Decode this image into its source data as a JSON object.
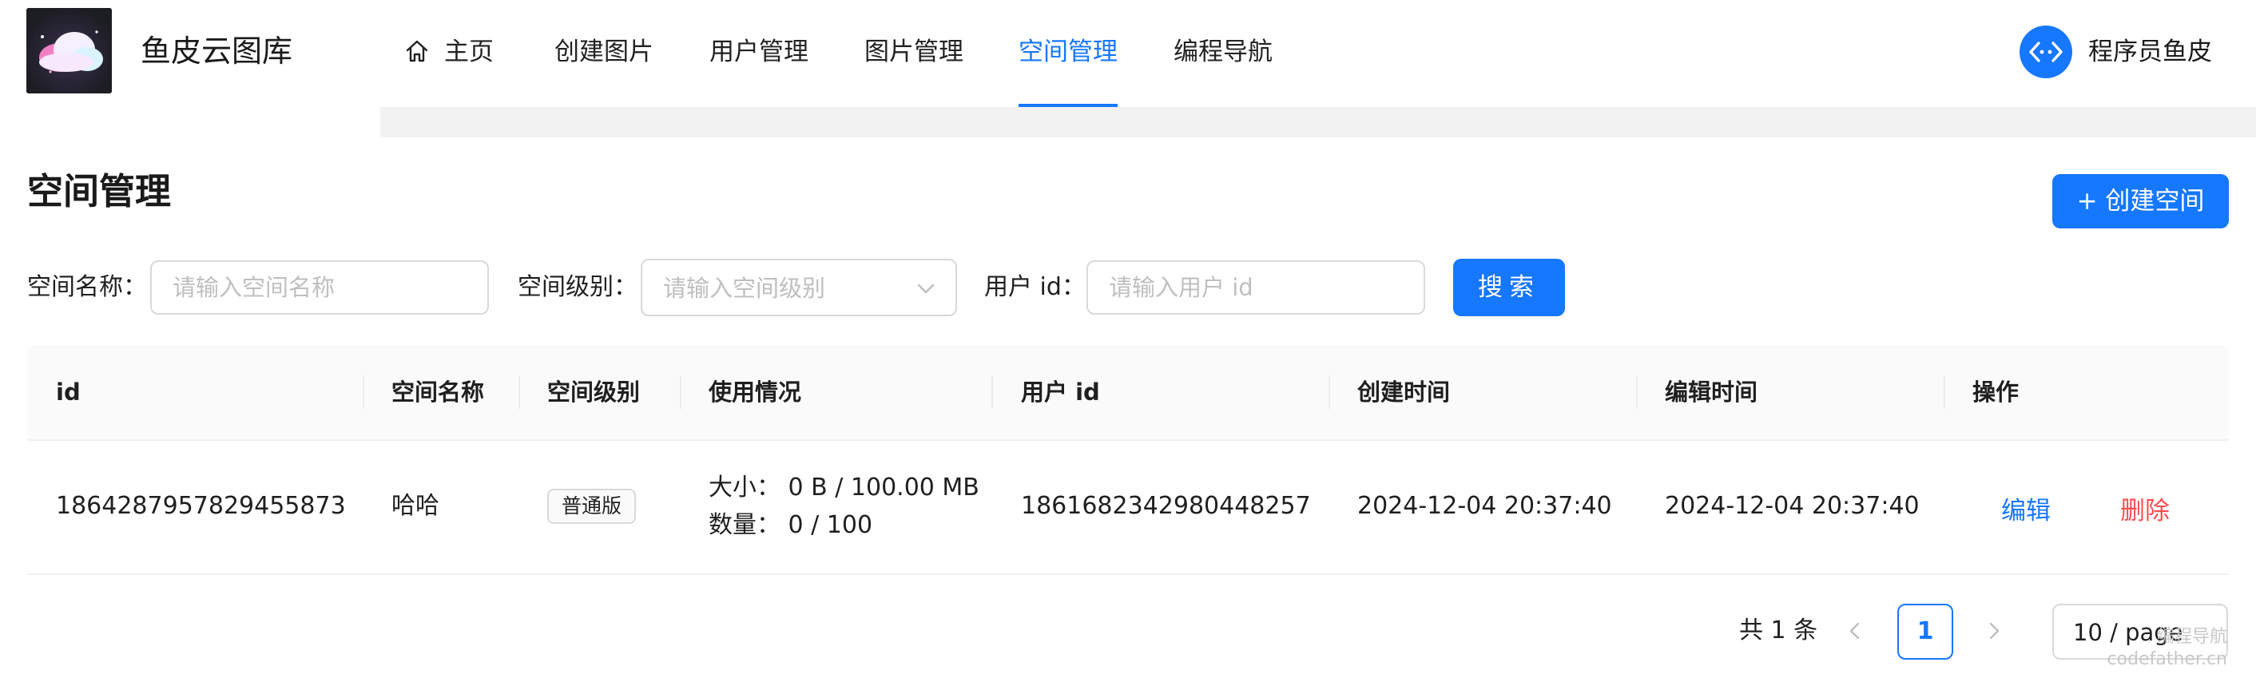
{
  "app": {
    "name": "鱼皮云图库"
  },
  "nav": {
    "items": [
      {
        "label": "主页",
        "icon": "home-icon"
      },
      {
        "label": "创建图片"
      },
      {
        "label": "用户管理"
      },
      {
        "label": "图片管理"
      },
      {
        "label": "空间管理",
        "active": true
      },
      {
        "label": "编程导航"
      }
    ]
  },
  "user": {
    "name": "程序员鱼皮"
  },
  "page": {
    "title": "空间管理",
    "create_button": "+ 创建空间"
  },
  "filters": {
    "space_name": {
      "label": "空间名称：",
      "placeholder": "请输入空间名称"
    },
    "space_level": {
      "label": "空间级别：",
      "placeholder": "请输入空间级别"
    },
    "user_id": {
      "label": "用户 id：",
      "placeholder": "请输入用户 id"
    },
    "search_button": "搜索"
  },
  "table": {
    "columns": [
      "id",
      "空间名称",
      "空间级别",
      "使用情况",
      "用户 id",
      "创建时间",
      "编辑时间",
      "操作"
    ],
    "rows": [
      {
        "id": "1864287957829455873",
        "space_name": "哈哈",
        "space_level": "普通版",
        "usage_size": "大小：  0 B / 100.00 MB",
        "usage_count": "数量：  0 / 100",
        "user_id": "1861682342980448257",
        "create_time": "2024-12-04 20:37:40",
        "edit_time": "2024-12-04 20:37:40",
        "edit_label": "编辑",
        "delete_label": "删除"
      }
    ]
  },
  "pagination": {
    "total_label": "共 1 条",
    "current_page": "1",
    "page_size": "10 / page"
  },
  "watermark": {
    "line1": "编程导航",
    "line2": "codefather.cn"
  },
  "colors": {
    "primary": "#1677ff",
    "danger": "#ff4d4f",
    "border": "#d9d9d9",
    "header_bg": "#fafafa"
  }
}
